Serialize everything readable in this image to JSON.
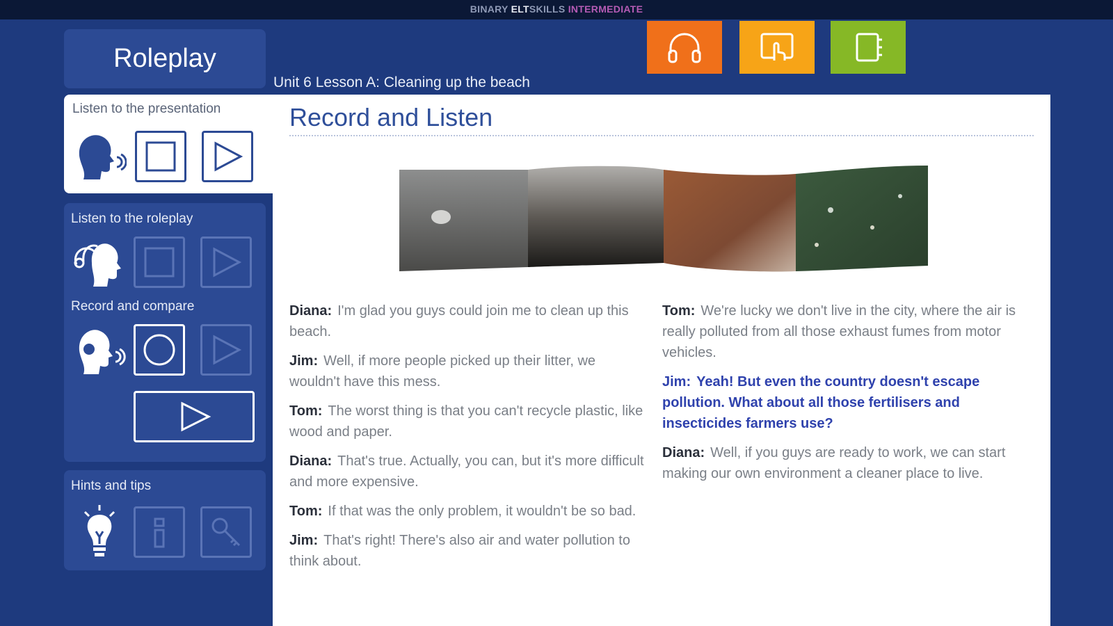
{
  "header": {
    "brand_part1": "BINARY ",
    "brand_part2": "ELT",
    "brand_part3": "SKILLS ",
    "brand_part4": "INTERMEDIATE"
  },
  "sidebar": {
    "title": "Roleplay",
    "sections": {
      "presentation": {
        "label": "Listen to the presentation"
      },
      "roleplay": {
        "label": "Listen to the roleplay"
      },
      "record": {
        "label": "Record and compare"
      },
      "hints": {
        "label": "Hints and tips"
      }
    }
  },
  "toolbar": {
    "icons": [
      "headphones-icon",
      "touch-icon",
      "notebook-icon"
    ]
  },
  "unit_title": "Unit 6 Lesson A: Cleaning up the beach",
  "main": {
    "title": "Record and Listen",
    "dialogue_left": [
      {
        "speaker": "Diana:",
        "text": "I'm glad you guys could join me to clean up this beach."
      },
      {
        "speaker": "Jim:",
        "text": "Well, if more people picked up their litter, we wouldn't have this mess."
      },
      {
        "speaker": "Tom:",
        "text": "The worst thing is that you can't recycle plastic, like wood and paper."
      },
      {
        "speaker": "Diana:",
        "text": "That's true. Actually, you can, but it's more difficult and more expensive."
      },
      {
        "speaker": "Tom:",
        "text": "If that was the only problem, it wouldn't be so bad."
      },
      {
        "speaker": "Jim:",
        "text": "That's right! There's also air and water pollution to think about."
      }
    ],
    "dialogue_right": [
      {
        "speaker": "Tom:",
        "text": "We're lucky we don't live in the city, where the air is really polluted from all those exhaust fumes from motor vehicles."
      },
      {
        "speaker": "Jim:",
        "text": "Yeah! But even the country doesn't escape pollution. What about all those fertilisers and insecticides farmers use?"
      },
      {
        "speaker": "Diana:",
        "text": "Well, if you guys are ready to work, we can start making our own environment a cleaner place to live."
      }
    ]
  },
  "colors": {
    "background": "#1e3a7e",
    "orange": "#f0701a",
    "yellow": "#f7a417",
    "green": "#86b826",
    "highlight": "#2f42ad"
  }
}
